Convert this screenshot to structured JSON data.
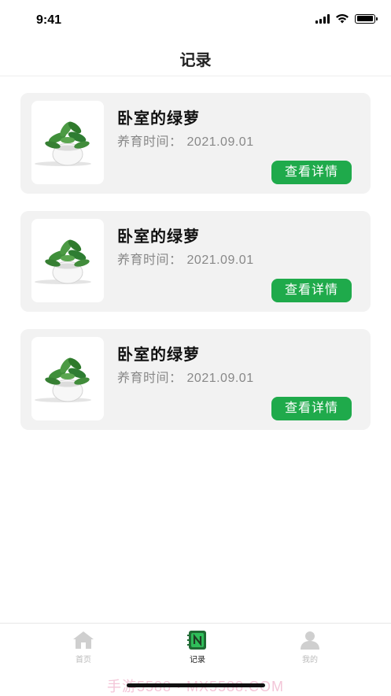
{
  "status_bar": {
    "time": "9:41"
  },
  "nav": {
    "title": "记录"
  },
  "records": [
    {
      "title": "卧室的绿萝",
      "meta_label": "养育时间：",
      "date": "2021.09.01",
      "button_label": "查看详情"
    },
    {
      "title": "卧室的绿萝",
      "meta_label": "养育时间：",
      "date": "2021.09.01",
      "button_label": "查看详情"
    },
    {
      "title": "卧室的绿萝",
      "meta_label": "养育时间：",
      "date": "2021.09.01",
      "button_label": "查看详情"
    }
  ],
  "tab_bar": {
    "tabs": [
      {
        "label": "首页",
        "icon": "home-icon",
        "active": false
      },
      {
        "label": "记录",
        "icon": "notebook-icon",
        "active": true
      },
      {
        "label": "我的",
        "icon": "user-icon",
        "active": false
      }
    ]
  },
  "watermark": "手游5588 · MX5588.COM",
  "colors": {
    "accent": "#1faa4b",
    "card_bg": "#f2f2f2",
    "inactive_tab": "#bbbbbb"
  }
}
